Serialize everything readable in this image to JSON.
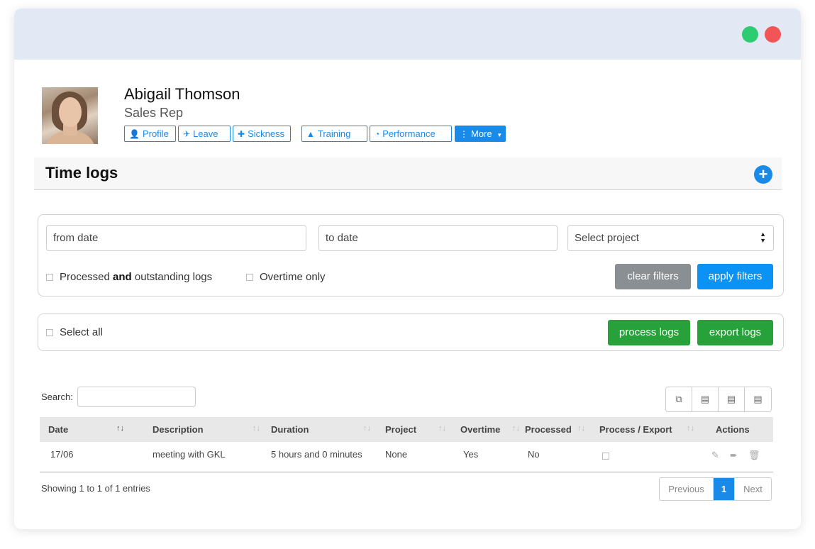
{
  "profile": {
    "name": "Abigail Thomson",
    "role": "Sales Rep"
  },
  "nav": [
    {
      "label": "Profile",
      "icon": "user-icon"
    },
    {
      "label": "Leave",
      "icon": "plane-icon"
    },
    {
      "label": "Sickness",
      "icon": "medkit-icon"
    },
    {
      "label": "Training",
      "icon": "graduation-cap-icon"
    },
    {
      "label": "Performance",
      "icon": "dashboard-icon"
    },
    {
      "label": "More",
      "icon": "ellipsis-vertical-icon"
    }
  ],
  "section": {
    "title": "Time logs"
  },
  "filters": {
    "from_placeholder": "from date",
    "to_placeholder": "to date",
    "project_selected": "Select project",
    "processed_pre": "Processed ",
    "processed_bold": "and",
    "processed_post": " outstanding logs",
    "overtime_label": "Overtime only",
    "clear_label": "clear filters",
    "apply_label": "apply filters"
  },
  "bulk": {
    "select_all_label": "Select all",
    "process_label": "process logs",
    "export_label": "export logs"
  },
  "table": {
    "search_label": "Search:",
    "columns": [
      "Date",
      "Description",
      "Duration",
      "Project",
      "Overtime",
      "Processed",
      "Process / Export",
      "Actions"
    ],
    "rows": [
      {
        "date": "17/06",
        "description": "meeting with GKL",
        "duration": "5 hours and 0 minutes",
        "project": "None",
        "overtime": "Yes",
        "processed": "No"
      }
    ],
    "info": "Showing 1 to 1 of 1 entries"
  },
  "pagination": {
    "previous": "Previous",
    "current": "1",
    "next": "Next"
  },
  "colors": {
    "accent": "#1a8ae8",
    "green": "#27a23a",
    "grey_button": "#8a8f94",
    "window_close": "#f25555",
    "window_max": "#2ecc71"
  }
}
